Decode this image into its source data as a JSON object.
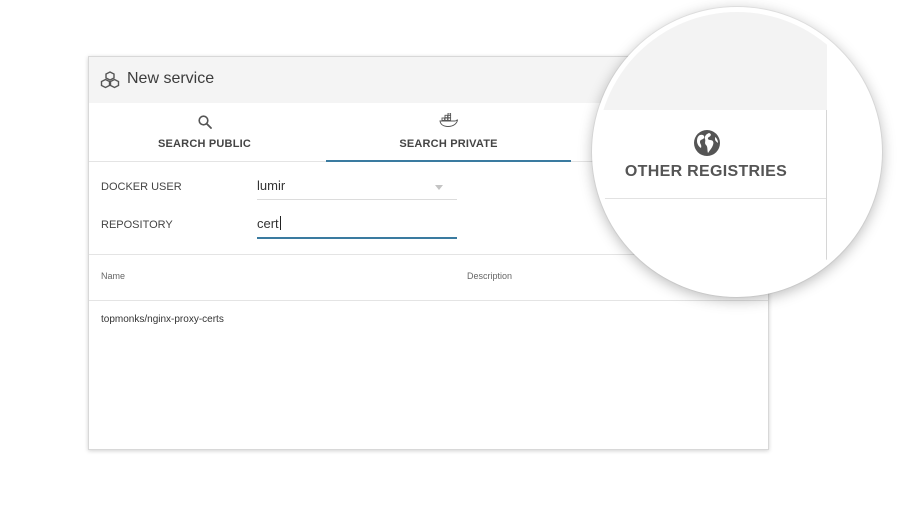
{
  "dialog": {
    "title": "New service",
    "icon": "cubes-icon"
  },
  "tabs": [
    {
      "label": "SEARCH PUBLIC",
      "icon": "search-icon",
      "active": false
    },
    {
      "label": "SEARCH PRIVATE",
      "icon": "docker-icon",
      "active": true
    },
    {
      "label": "OTHER REGISTRIES",
      "icon": "globe-icon",
      "active": false
    }
  ],
  "form": {
    "docker_user": {
      "label": "DOCKER USER",
      "value": "lumir"
    },
    "repository": {
      "label": "REPOSITORY",
      "value": "cert"
    }
  },
  "table": {
    "columns": [
      "Name",
      "Description"
    ],
    "rows": [
      {
        "name": "topmonks/nginx-proxy-certs",
        "description": ""
      }
    ]
  },
  "colors": {
    "accent": "#3a7ba0",
    "header_bg": "#f4f4f4"
  }
}
